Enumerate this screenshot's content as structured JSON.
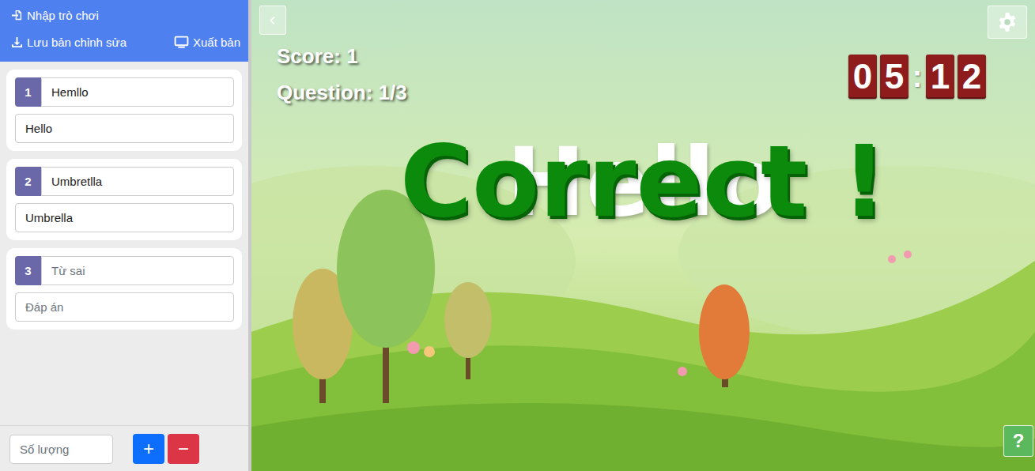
{
  "sidebar": {
    "import_button": "Nhập trò chơi",
    "save_button": "Lưu bản chỉnh sửa",
    "publish_button": "Xuất bản",
    "questions": [
      {
        "number": "1",
        "word": "Hemllo",
        "answer": "Hello",
        "word_placeholder": "Từ sai",
        "answer_placeholder": "Đáp án"
      },
      {
        "number": "2",
        "word": "Umbretlla",
        "answer": "Umbrella",
        "word_placeholder": "Từ sai",
        "answer_placeholder": "Đáp án"
      },
      {
        "number": "3",
        "word": "",
        "answer": "",
        "word_placeholder": "Từ sai",
        "answer_placeholder": "Đáp án"
      }
    ],
    "count_field": {
      "placeholder": "Số lượng",
      "value": ""
    },
    "add_button": "+",
    "remove_button": "−"
  },
  "game": {
    "score": "Score: 1",
    "question": "Question: 1/3",
    "timer": {
      "digits": [
        "0",
        "5",
        "1",
        "2"
      ],
      "separator": ":"
    },
    "word": "Hello",
    "feedback": "Correct !",
    "help_button": "?"
  }
}
